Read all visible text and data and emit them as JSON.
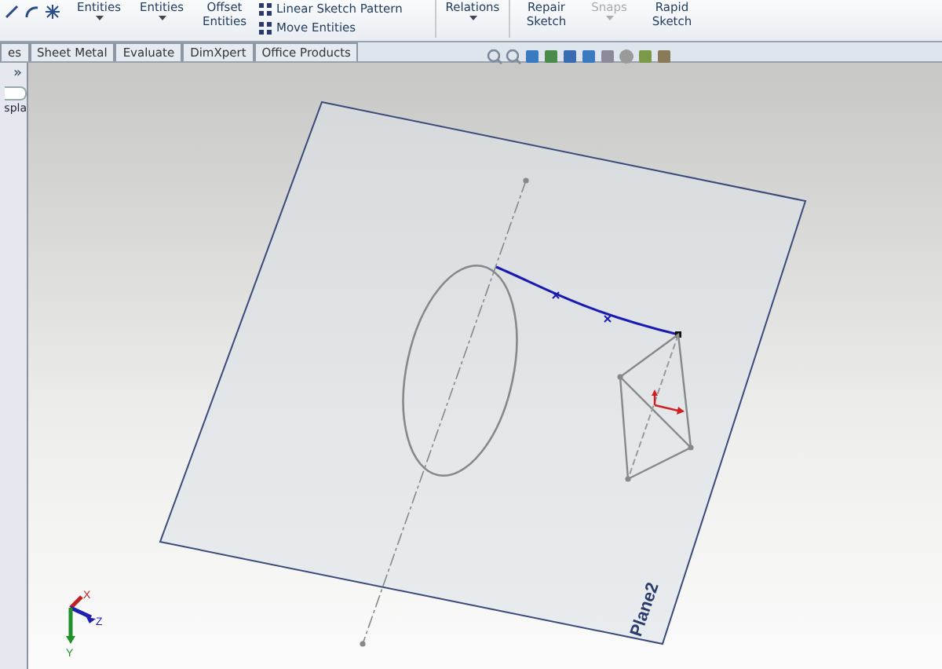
{
  "ribbon": {
    "items": [
      {
        "kind": "large",
        "label": "Entities",
        "caret": true,
        "disabled": false
      },
      {
        "kind": "large",
        "label": "Entities",
        "caret": true,
        "disabled": false
      },
      {
        "kind": "large",
        "label": "Offset Entities",
        "caret": false,
        "disabled": false
      },
      {
        "kind": "stack",
        "entries": [
          "Linear Sketch Pattern",
          "Move Entities"
        ]
      },
      {
        "kind": "large",
        "label": "Relations",
        "caret": true,
        "disabled": false
      },
      {
        "kind": "large",
        "label": "Repair Sketch",
        "caret": false,
        "disabled": false
      },
      {
        "kind": "large",
        "label": "Snaps",
        "caret": true,
        "disabled": true
      },
      {
        "kind": "large",
        "label": "Rapid Sketch",
        "caret": false,
        "disabled": false
      }
    ]
  },
  "tabs": [
    {
      "label": "es",
      "selected": false
    },
    {
      "label": "Sheet Metal",
      "selected": false
    },
    {
      "label": "Evaluate",
      "selected": false
    },
    {
      "label": "DimXpert",
      "selected": false
    },
    {
      "label": "Office Products",
      "selected": false
    }
  ],
  "side_panel": {
    "expand": "»",
    "text": "spla"
  },
  "viewport": {
    "plane_label": "Plane2",
    "triad": {
      "x": "X",
      "y": "Y",
      "z": "Z"
    }
  }
}
